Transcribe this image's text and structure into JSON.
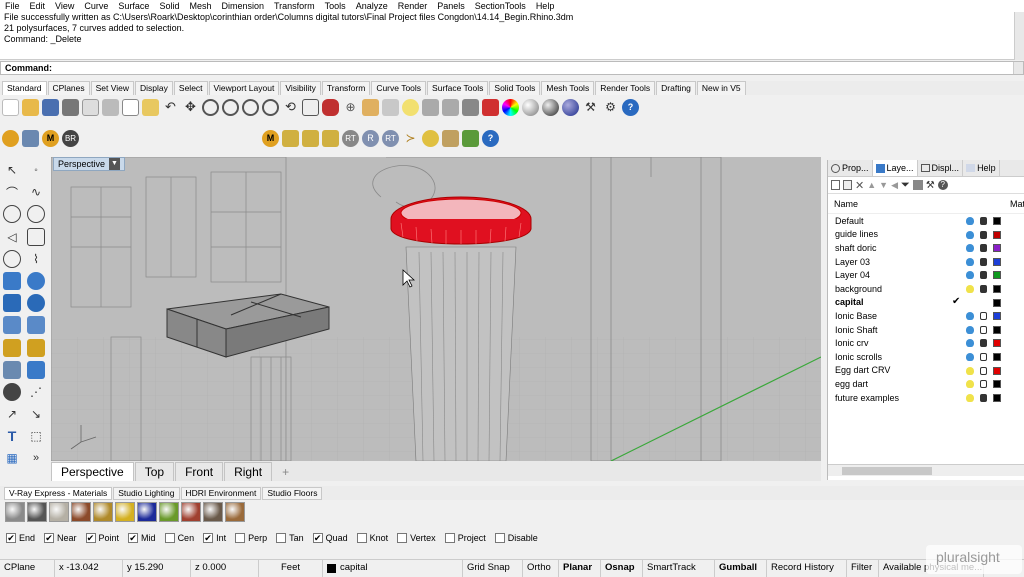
{
  "menu": [
    "File",
    "Edit",
    "View",
    "Curve",
    "Surface",
    "Solid",
    "Mesh",
    "Dimension",
    "Transform",
    "Tools",
    "Analyze",
    "Render",
    "Panels",
    "SectionTools",
    "Help"
  ],
  "history": [
    "File successfully written as C:\\Users\\Roark\\Desktop\\corinthian order\\Columns digital tutors\\Final Project files Congdon\\14.14_Begin.Rhino.3dm",
    "21 polysurfaces, 7 curves added to selection.",
    "Command: _Delete"
  ],
  "command_label": "Command:",
  "toolbar_tabs": [
    "Standard",
    "CPlanes",
    "Set View",
    "Display",
    "Select",
    "Viewport Layout",
    "Visibility",
    "Transform",
    "Curve Tools",
    "Surface Tools",
    "Solid Tools",
    "Mesh Tools",
    "Render Tools",
    "Drafting",
    "New in V5"
  ],
  "viewport": {
    "title": "Perspective",
    "dropdown_icon": "caret-down"
  },
  "viewport_tabs": [
    "Perspective",
    "Top",
    "Front",
    "Right"
  ],
  "panel_tabs": [
    "Prop...",
    "Laye...",
    "Displ...",
    "Help"
  ],
  "layers_header": {
    "name": "Name",
    "material": "Mat"
  },
  "layers": [
    {
      "name": "Default",
      "bulb": "#3c8fd6",
      "color": "#000000",
      "current": false,
      "unlocked": false
    },
    {
      "name": "guide lines",
      "bulb": "#3c8fd6",
      "color": "#c00000",
      "current": false,
      "unlocked": false
    },
    {
      "name": "shaft doric",
      "bulb": "#3c8fd6",
      "color": "#8a1fc8",
      "current": false,
      "unlocked": false
    },
    {
      "name": "Layer 03",
      "bulb": "#3c8fd6",
      "color": "#1c3fd8",
      "current": false,
      "unlocked": false
    },
    {
      "name": "Layer 04",
      "bulb": "#3c8fd6",
      "color": "#0f9a1f",
      "current": false,
      "unlocked": false
    },
    {
      "name": "background",
      "bulb": "#f0e24a",
      "color": "#000000",
      "current": false,
      "unlocked": false
    },
    {
      "name": "capital",
      "bulb": "",
      "color": "#000000",
      "current": true,
      "unlocked": false
    },
    {
      "name": "Ionic Base",
      "bulb": "#3c8fd6",
      "color": "#1c3fd8",
      "current": false,
      "unlocked": true
    },
    {
      "name": "Ionic Shaft",
      "bulb": "#3c8fd6",
      "color": "#000000",
      "current": false,
      "unlocked": true
    },
    {
      "name": "Ionic crv",
      "bulb": "#3c8fd6",
      "color": "#e00000",
      "current": false,
      "unlocked": false
    },
    {
      "name": "Ionic scrolls",
      "bulb": "#3c8fd6",
      "color": "#000000",
      "current": false,
      "unlocked": true
    },
    {
      "name": "Egg dart CRV",
      "bulb": "#f0e24a",
      "color": "#e00000",
      "current": false,
      "unlocked": true
    },
    {
      "name": "egg dart",
      "bulb": "#f0e24a",
      "color": "#000000",
      "current": false,
      "unlocked": true
    },
    {
      "name": "future examples",
      "bulb": "#f0e24a",
      "color": "#000000",
      "current": false,
      "unlocked": false
    }
  ],
  "material_tabs": [
    "V-Ray Express - Materials",
    "Studio Lighting",
    "HDRI Environment",
    "Studio Floors"
  ],
  "swatches": [
    "#8a8a8a",
    "#555555",
    "#b5b0a5",
    "#8c4a2a",
    "#b08a2a",
    "#d4b020",
    "#1c2a9a",
    "#6a9a2a",
    "#a04030",
    "#6a5a4a",
    "#9a6a3a"
  ],
  "osnaps": [
    {
      "label": "End",
      "checked": true
    },
    {
      "label": "Near",
      "checked": true
    },
    {
      "label": "Point",
      "checked": true
    },
    {
      "label": "Mid",
      "checked": true
    },
    {
      "label": "Cen",
      "checked": false
    },
    {
      "label": "Int",
      "checked": true
    },
    {
      "label": "Perp",
      "checked": false
    },
    {
      "label": "Tan",
      "checked": false
    },
    {
      "label": "Quad",
      "checked": true
    },
    {
      "label": "Knot",
      "checked": false
    },
    {
      "label": "Vertex",
      "checked": false
    },
    {
      "label": "Project",
      "checked": false
    },
    {
      "label": "Disable",
      "checked": false
    }
  ],
  "status": {
    "cplane": "CPlane",
    "x": "x -13.042",
    "y": "y 15.290",
    "z": "z 0.000",
    "units": "Feet",
    "layer": "capital",
    "grid_snap": "Grid Snap",
    "ortho": "Ortho",
    "planar": "Planar",
    "osnap": "Osnap",
    "smarttrack": "SmartTrack",
    "gumball": "Gumball",
    "record_history": "Record History",
    "filter": "Filter",
    "available": "Available physical me..."
  },
  "watermark": "pluralsight",
  "colors": {
    "selection": "#e01020",
    "viewport_bg": "#b8b8b8",
    "active_tab": "#ffffff"
  }
}
